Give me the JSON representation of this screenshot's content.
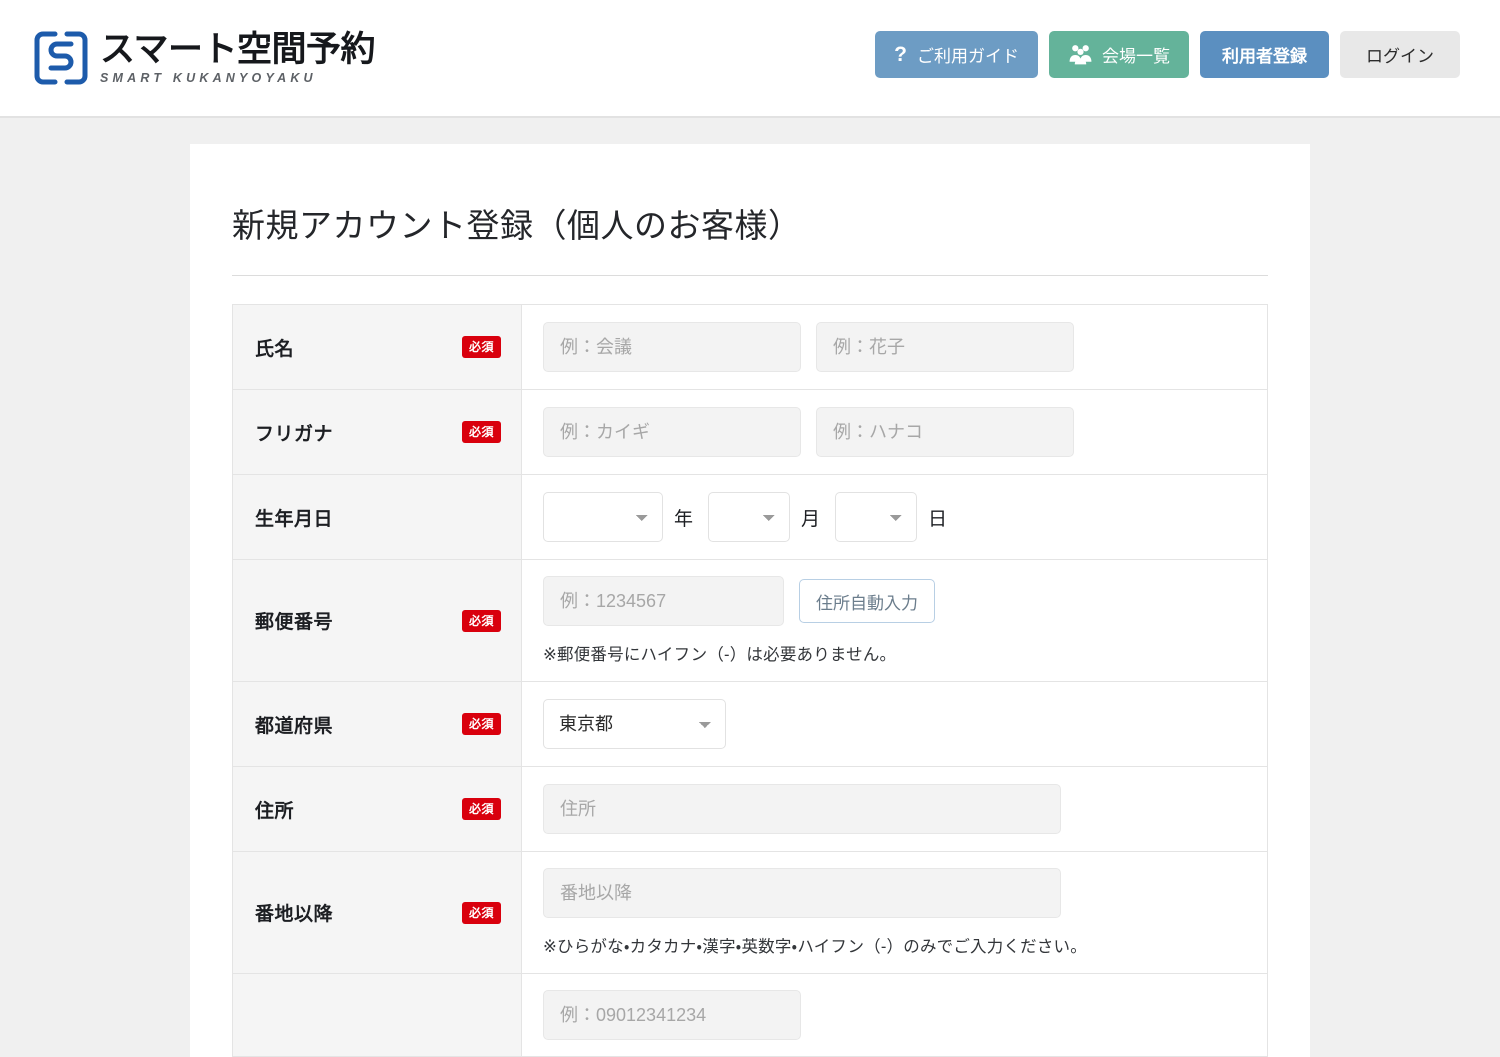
{
  "header": {
    "logo": {
      "mark_icon": "brackets-s-logo-icon",
      "title": "スマート空間予約",
      "subtitle": "SMART KUKANYOYAKU",
      "color": "#1d5bab"
    },
    "buttons": [
      {
        "id": "guide",
        "label": "ご利用ガイド",
        "icon": "question-mark-icon",
        "color": "#6d9cc4"
      },
      {
        "id": "venues",
        "label": "会場一覧",
        "icon": "people-group-icon",
        "color": "#64b39a"
      },
      {
        "id": "signup",
        "label": "利用者登録",
        "icon": null,
        "color": "#5b8fc0"
      },
      {
        "id": "login",
        "label": "ログイン",
        "icon": null,
        "color": "#e8e8e8"
      }
    ]
  },
  "page": {
    "title": "新規アカウント登録（個人のお客様）"
  },
  "required_badge": {
    "label": "必須",
    "color": "#d9000d"
  },
  "form": {
    "name": {
      "label": "氏名",
      "last_placeholder": "例：会議",
      "first_placeholder": "例：花子"
    },
    "kana": {
      "label": "フリガナ",
      "last_placeholder": "例：カイギ",
      "first_placeholder": "例：ハナコ"
    },
    "birthdate": {
      "label": "生年月日",
      "year_value": "",
      "year_unit": "年",
      "month_value": "",
      "month_unit": "月",
      "day_value": "",
      "day_unit": "日"
    },
    "postal": {
      "label": "郵便番号",
      "placeholder": "例：1234567",
      "autofill_button": "住所自動入力",
      "note": "※郵便番号にハイフン（-）は必要ありません。"
    },
    "prefecture": {
      "label": "都道府県",
      "value": "東京都"
    },
    "address": {
      "label": "住所",
      "placeholder": "住所"
    },
    "street": {
      "label": "番地以降",
      "placeholder": "番地以降",
      "note": "※ひらがな・カタカナ・漢字・英数字・ハイフン（-）のみでご入力ください。"
    },
    "phone": {
      "placeholder": "例：09012341234"
    }
  }
}
